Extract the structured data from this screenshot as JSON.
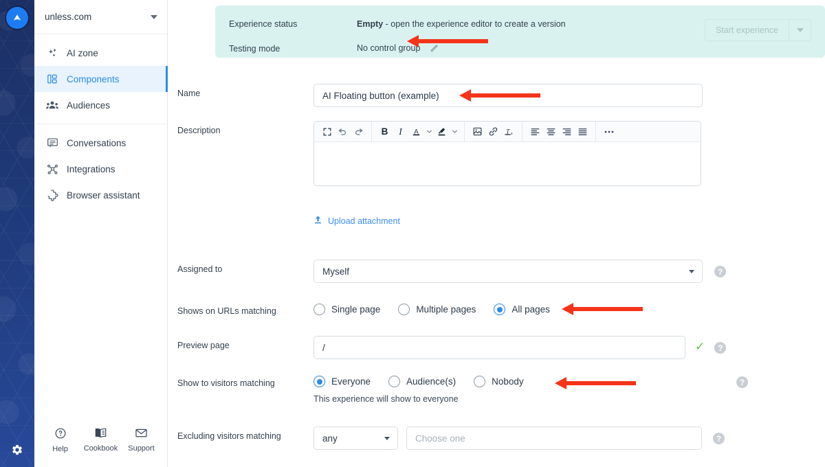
{
  "rail": {
    "logo_icon": "unless-logo-icon",
    "settings_icon": "gear-icon"
  },
  "sidebar": {
    "workspace": {
      "name": "unless.com",
      "caret_icon": "chevron-down-icon"
    },
    "groups": [
      {
        "items": [
          {
            "label": "AI zone",
            "icon": "sparkles-icon",
            "active": false
          },
          {
            "label": "Components",
            "icon": "components-grid-icon",
            "active": true
          },
          {
            "label": "Audiences",
            "icon": "people-group-icon",
            "active": false
          }
        ]
      },
      {
        "items": [
          {
            "label": "Conversations",
            "icon": "chat-bubble-icon",
            "active": false
          },
          {
            "label": "Integrations",
            "icon": "nodes-network-icon",
            "active": false
          },
          {
            "label": "Browser assistant",
            "icon": "puzzle-piece-icon",
            "active": false
          }
        ]
      }
    ],
    "footer": [
      {
        "label": "Help",
        "icon": "question-circle-icon"
      },
      {
        "label": "Cookbook",
        "icon": "book-icon"
      },
      {
        "label": "Support",
        "icon": "envelope-icon"
      }
    ]
  },
  "banner": {
    "status_label": "Experience status",
    "status_value_bold": "Empty",
    "status_value_rest": " - open the experience editor to create a version",
    "testing_label": "Testing mode",
    "testing_value": "No control group",
    "edit_icon": "pencil-icon",
    "start_button": "Start experience",
    "start_caret_icon": "chevron-down-icon",
    "background_color": "#d9f2f0"
  },
  "form": {
    "name": {
      "label": "Name",
      "value": "AI Floating button (example)"
    },
    "description": {
      "label": "Description",
      "body_value": "",
      "toolbar": [
        {
          "name": "fullscreen-icon",
          "glyph": "fullscreen"
        },
        {
          "name": "undo-icon",
          "glyph": "undo"
        },
        {
          "name": "redo-icon",
          "glyph": "redo"
        },
        {
          "name": "bold-icon",
          "glyph": "B"
        },
        {
          "name": "italic-icon",
          "glyph": "I"
        },
        {
          "name": "font-color-icon",
          "glyph": "A"
        },
        {
          "name": "font-color-chevron-icon",
          "glyph": "chevron"
        },
        {
          "name": "highlight-color-icon",
          "glyph": "pen"
        },
        {
          "name": "highlight-color-chevron-icon",
          "glyph": "chevron"
        },
        {
          "name": "insert-image-icon",
          "glyph": "image"
        },
        {
          "name": "insert-link-icon",
          "glyph": "link"
        },
        {
          "name": "clear-formatting-icon",
          "glyph": "Tx"
        },
        {
          "name": "align-left-icon",
          "glyph": "align-left"
        },
        {
          "name": "align-center-icon",
          "glyph": "align-center"
        },
        {
          "name": "align-right-icon",
          "glyph": "align-right"
        },
        {
          "name": "align-justify-icon",
          "glyph": "align-justify"
        },
        {
          "name": "more-options-icon",
          "glyph": "…"
        }
      ]
    },
    "upload": {
      "label": "Upload attachment",
      "icon": "upload-icon"
    },
    "assigned_to": {
      "label": "Assigned to",
      "value": "Myself",
      "caret_icon": "chevron-down-icon",
      "help_icon": "question-mark-icon"
    },
    "urls_matching": {
      "label": "Shows on URLs matching",
      "options": [
        {
          "label": "Single page",
          "selected": false
        },
        {
          "label": "Multiple pages",
          "selected": false
        },
        {
          "label": "All pages",
          "selected": true
        }
      ]
    },
    "preview_page": {
      "label": "Preview page",
      "value": "/",
      "valid_icon": "checkmark-icon",
      "help_icon": "question-mark-icon"
    },
    "visitors_matching": {
      "label": "Show to visitors matching",
      "options": [
        {
          "label": "Everyone",
          "selected": true
        },
        {
          "label": "Audience(s)",
          "selected": false
        },
        {
          "label": "Nobody",
          "selected": false
        }
      ],
      "hint": "This experience will show to everyone",
      "help_icon": "question-mark-icon"
    },
    "excluding_visitors": {
      "label": "Excluding visitors matching",
      "operator_value": "any",
      "operator_caret_icon": "chevron-down-icon",
      "chooser_placeholder": "Choose one",
      "chooser_value": "",
      "help_icon": "question-mark-icon"
    }
  },
  "annotations": {
    "color": "#f4341a",
    "arrows": [
      {
        "name": "arrow-testing-mode"
      },
      {
        "name": "arrow-name-field"
      },
      {
        "name": "arrow-all-pages"
      },
      {
        "name": "arrow-nobody"
      }
    ]
  }
}
